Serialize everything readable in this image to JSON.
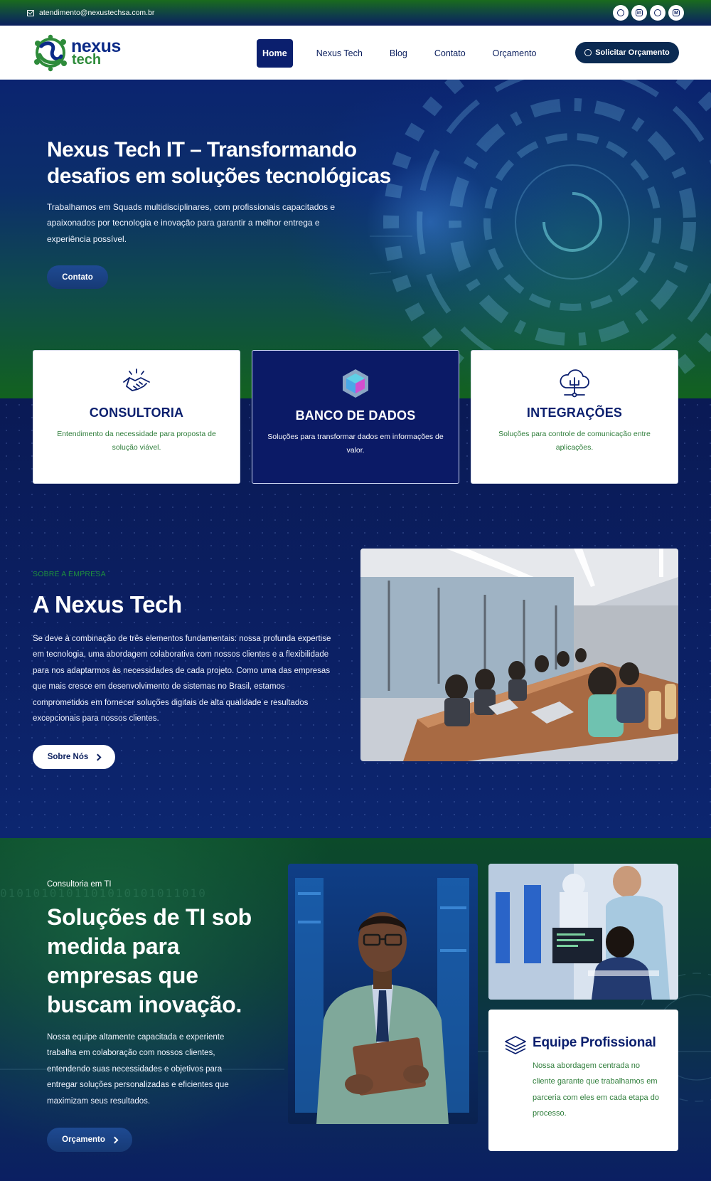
{
  "topbar": {
    "email": "atendimento@nexustechsa.com.br",
    "socials": [
      "instagram-icon",
      "linkedin-icon",
      "github-icon",
      "medium-icon"
    ]
  },
  "header": {
    "logo_line1": "nexus",
    "logo_line2": "tech",
    "nav": [
      "Home",
      "Nexus Tech",
      "Blog",
      "Contato",
      "Orçamento"
    ],
    "cta": "Solicitar Orçamento"
  },
  "hero": {
    "title": "Nexus Tech IT – Transformando desafios em soluções tecnológicas",
    "text": "Trabalhamos em Squads multidisciplinares, com profissionais capacitados e apaixonados por tecnologia e inovação para garantir a melhor entrega e experiência possível.",
    "button": "Contato"
  },
  "cards": [
    {
      "title": "CONSULTORIA",
      "text": "Entendimento da necessidade para proposta de solução viável.",
      "icon": "handshake-icon"
    },
    {
      "title": "BANCO DE DADOS",
      "text": "Soluções para transformar dados em informações de valor.",
      "icon": "cube-icon"
    },
    {
      "title": "INTEGRAÇÕES",
      "text": "Soluções para controle de comunicação entre aplicações.",
      "icon": "cloud-network-icon"
    }
  ],
  "about": {
    "eyebrow": "SOBRE A EMPRESA",
    "title": "A Nexus Tech",
    "text": "Se deve à combinação de três elementos fundamentais: nossa profunda expertise em tecnologia, uma abordagem colaborativa com nossos clientes e a flexibilidade para nos adaptarmos às necessidades de cada projeto. Como uma das empresas que mais cresce em desenvolvimento de sistemas no Brasil, estamos comprometidos em fornecer soluções digitais de alta qualidade e resultados excepcionais para nossos clientes.",
    "button": "Sobre Nós"
  },
  "services": {
    "eyebrow": "Consultoria em TI",
    "title": "Soluções de TI sob medida para empresas que buscam inovação.",
    "text": "Nossa equipe altamente capacitada e experiente trabalha em colaboração com nossos clientes, entendendo suas necessidades e objetivos para entregar soluções personalizadas e eficientes que maximizam seus resultados.",
    "button": "Orçamento",
    "binary": "0101010101101010101011010"
  },
  "team_card": {
    "title": "Equipe Profissional",
    "text": "Nossa abordagem centrada no cliente garante que trabalhamos em parceria com eles em cada etapa do processo.",
    "icon": "layers-icon"
  },
  "colors": {
    "navy": "#0b1f6e",
    "green": "#2e7d3a",
    "dark_bg": "#0a1a55"
  }
}
